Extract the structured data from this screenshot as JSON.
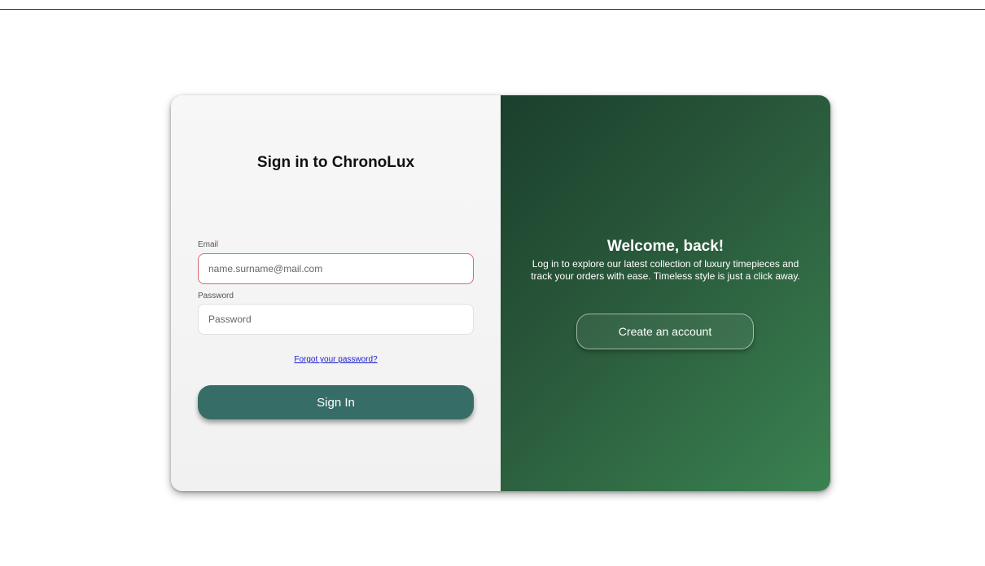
{
  "signin": {
    "title": "Sign in to ChronoLux",
    "email_label": "Email",
    "email_placeholder": "name.surname@mail.com",
    "password_label": "Password",
    "password_placeholder": "Password",
    "forgot_link": "Forgot your password?",
    "submit_label": "Sign In"
  },
  "welcome": {
    "title": "Welcome, back!",
    "text": "Log in to explore our latest collection of luxury timepieces and track your orders with ease. Timeless style is just a click away.",
    "create_account_label": "Create an account"
  },
  "colors": {
    "primary_button": "#366d67",
    "panel_green_dark": "#1b3f2c",
    "panel_green_light": "#3a8251",
    "error_border": "#d96a6a",
    "link": "#1a1acc"
  }
}
